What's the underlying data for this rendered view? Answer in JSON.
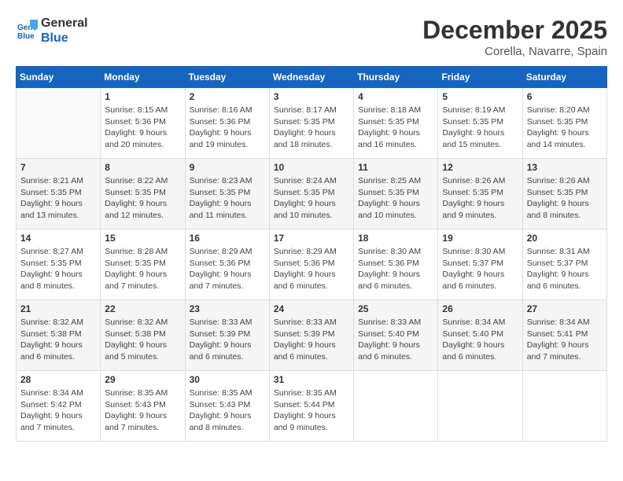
{
  "header": {
    "logo_line1": "General",
    "logo_line2": "Blue",
    "month_title": "December 2025",
    "location": "Corella, Navarre, Spain"
  },
  "days_of_week": [
    "Sunday",
    "Monday",
    "Tuesday",
    "Wednesday",
    "Thursday",
    "Friday",
    "Saturday"
  ],
  "weeks": [
    [
      {
        "day": "",
        "info": ""
      },
      {
        "day": "1",
        "info": "Sunrise: 8:15 AM\nSunset: 5:36 PM\nDaylight: 9 hours\nand 20 minutes."
      },
      {
        "day": "2",
        "info": "Sunrise: 8:16 AM\nSunset: 5:36 PM\nDaylight: 9 hours\nand 19 minutes."
      },
      {
        "day": "3",
        "info": "Sunrise: 8:17 AM\nSunset: 5:35 PM\nDaylight: 9 hours\nand 18 minutes."
      },
      {
        "day": "4",
        "info": "Sunrise: 8:18 AM\nSunset: 5:35 PM\nDaylight: 9 hours\nand 16 minutes."
      },
      {
        "day": "5",
        "info": "Sunrise: 8:19 AM\nSunset: 5:35 PM\nDaylight: 9 hours\nand 15 minutes."
      },
      {
        "day": "6",
        "info": "Sunrise: 8:20 AM\nSunset: 5:35 PM\nDaylight: 9 hours\nand 14 minutes."
      }
    ],
    [
      {
        "day": "7",
        "info": "Sunrise: 8:21 AM\nSunset: 5:35 PM\nDaylight: 9 hours\nand 13 minutes."
      },
      {
        "day": "8",
        "info": "Sunrise: 8:22 AM\nSunset: 5:35 PM\nDaylight: 9 hours\nand 12 minutes."
      },
      {
        "day": "9",
        "info": "Sunrise: 8:23 AM\nSunset: 5:35 PM\nDaylight: 9 hours\nand 11 minutes."
      },
      {
        "day": "10",
        "info": "Sunrise: 8:24 AM\nSunset: 5:35 PM\nDaylight: 9 hours\nand 10 minutes."
      },
      {
        "day": "11",
        "info": "Sunrise: 8:25 AM\nSunset: 5:35 PM\nDaylight: 9 hours\nand 10 minutes."
      },
      {
        "day": "12",
        "info": "Sunrise: 8:26 AM\nSunset: 5:35 PM\nDaylight: 9 hours\nand 9 minutes."
      },
      {
        "day": "13",
        "info": "Sunrise: 8:26 AM\nSunset: 5:35 PM\nDaylight: 9 hours\nand 8 minutes."
      }
    ],
    [
      {
        "day": "14",
        "info": "Sunrise: 8:27 AM\nSunset: 5:35 PM\nDaylight: 9 hours\nand 8 minutes."
      },
      {
        "day": "15",
        "info": "Sunrise: 8:28 AM\nSunset: 5:35 PM\nDaylight: 9 hours\nand 7 minutes."
      },
      {
        "day": "16",
        "info": "Sunrise: 8:29 AM\nSunset: 5:36 PM\nDaylight: 9 hours\nand 7 minutes."
      },
      {
        "day": "17",
        "info": "Sunrise: 8:29 AM\nSunset: 5:36 PM\nDaylight: 9 hours\nand 6 minutes."
      },
      {
        "day": "18",
        "info": "Sunrise: 8:30 AM\nSunset: 5:36 PM\nDaylight: 9 hours\nand 6 minutes."
      },
      {
        "day": "19",
        "info": "Sunrise: 8:30 AM\nSunset: 5:37 PM\nDaylight: 9 hours\nand 6 minutes."
      },
      {
        "day": "20",
        "info": "Sunrise: 8:31 AM\nSunset: 5:37 PM\nDaylight: 9 hours\nand 6 minutes."
      }
    ],
    [
      {
        "day": "21",
        "info": "Sunrise: 8:32 AM\nSunset: 5:38 PM\nDaylight: 9 hours\nand 6 minutes."
      },
      {
        "day": "22",
        "info": "Sunrise: 8:32 AM\nSunset: 5:38 PM\nDaylight: 9 hours\nand 5 minutes."
      },
      {
        "day": "23",
        "info": "Sunrise: 8:33 AM\nSunset: 5:39 PM\nDaylight: 9 hours\nand 6 minutes."
      },
      {
        "day": "24",
        "info": "Sunrise: 8:33 AM\nSunset: 5:39 PM\nDaylight: 9 hours\nand 6 minutes."
      },
      {
        "day": "25",
        "info": "Sunrise: 8:33 AM\nSunset: 5:40 PM\nDaylight: 9 hours\nand 6 minutes."
      },
      {
        "day": "26",
        "info": "Sunrise: 8:34 AM\nSunset: 5:40 PM\nDaylight: 9 hours\nand 6 minutes."
      },
      {
        "day": "27",
        "info": "Sunrise: 8:34 AM\nSunset: 5:41 PM\nDaylight: 9 hours\nand 7 minutes."
      }
    ],
    [
      {
        "day": "28",
        "info": "Sunrise: 8:34 AM\nSunset: 5:42 PM\nDaylight: 9 hours\nand 7 minutes."
      },
      {
        "day": "29",
        "info": "Sunrise: 8:35 AM\nSunset: 5:43 PM\nDaylight: 9 hours\nand 7 minutes."
      },
      {
        "day": "30",
        "info": "Sunrise: 8:35 AM\nSunset: 5:43 PM\nDaylight: 9 hours\nand 8 minutes."
      },
      {
        "day": "31",
        "info": "Sunrise: 8:35 AM\nSunset: 5:44 PM\nDaylight: 9 hours\nand 9 minutes."
      },
      {
        "day": "",
        "info": ""
      },
      {
        "day": "",
        "info": ""
      },
      {
        "day": "",
        "info": ""
      }
    ]
  ]
}
